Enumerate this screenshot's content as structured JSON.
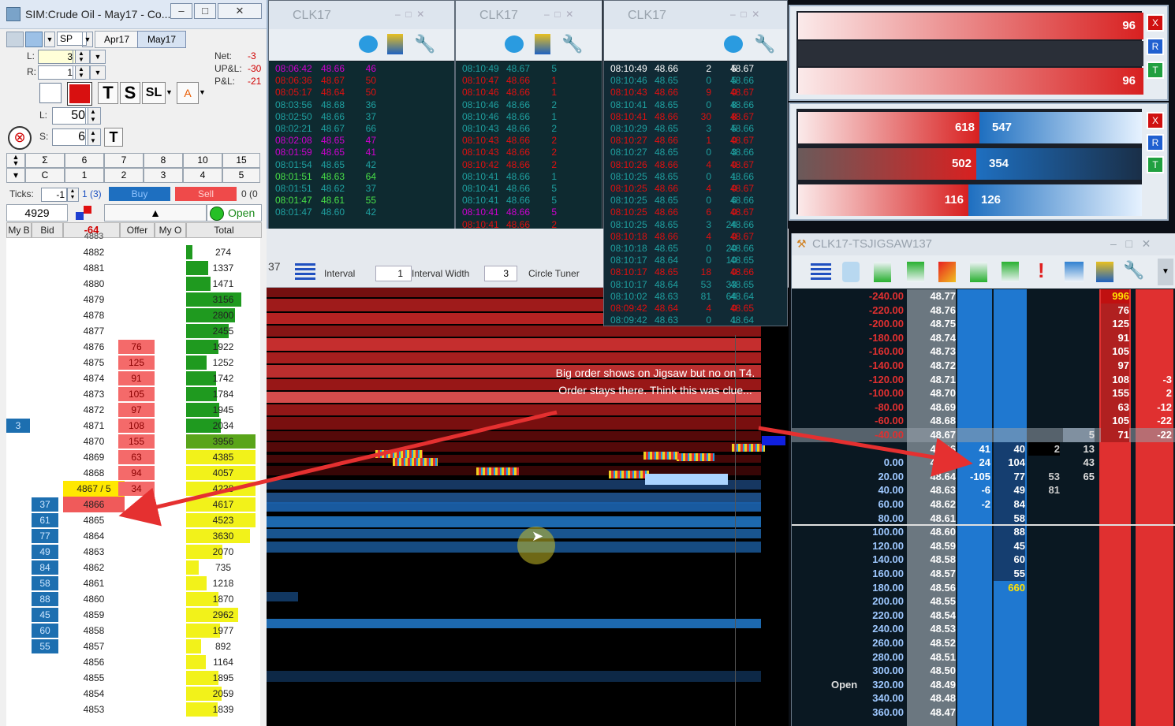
{
  "dom": {
    "title": "SIM:Crude Oil - May17 - Co...",
    "sp": "SP",
    "months": [
      "Apr17",
      "May17"
    ],
    "L_label": "L:",
    "L_value": "3",
    "R_label": "R:",
    "R_value": "1",
    "net_label": "Net:",
    "net_value": "-3",
    "upl_label": "UP&L:",
    "upl_value": "-30",
    "pl_label": "P&L:",
    "pl_value": "-21",
    "lot_L_label": "L:",
    "lot_L_value": "50",
    "lot_S_label": "S:",
    "lot_S_value": "6",
    "btn_T": "T",
    "btn_S": "S",
    "btn_SL": "SL",
    "btn_T2": "T",
    "grid_top": [
      "Σ",
      "6",
      "7",
      "8",
      "10",
      "15"
    ],
    "grid_bottom": [
      "C",
      "1",
      "2",
      "3",
      "4",
      "5"
    ],
    "ticks_label": "Ticks:",
    "ticks_value": "-1",
    "ticks_info": "1 (3)",
    "buy": "Buy",
    "sell": "Sell",
    "side_info": "0 (0",
    "last_price": "4929",
    "status": "Open",
    "headers": [
      "My B",
      "Bid",
      "-64",
      "Offer",
      "My O",
      "Total"
    ],
    "top_cut": "4883",
    "rows": [
      {
        "p": "4882",
        "t": "274",
        "tw": 8,
        "tc": "#1f9a1f"
      },
      {
        "p": "4881",
        "t": "1337",
        "tw": 30,
        "tc": "#1f9a1f"
      },
      {
        "p": "4880",
        "t": "1471",
        "tw": 33,
        "tc": "#1f9a1f"
      },
      {
        "p": "4879",
        "t": "3156",
        "tw": 74,
        "tc": "#1f9a1f"
      },
      {
        "p": "4878",
        "t": "2800",
        "tw": 66,
        "tc": "#1f9a1f"
      },
      {
        "p": "4877",
        "t": "2455",
        "tw": 57,
        "tc": "#1f9a1f"
      },
      {
        "p": "4876",
        "o": "76",
        "t": "1922",
        "tw": 44,
        "tc": "#1f9a1f"
      },
      {
        "p": "4875",
        "o": "125",
        "t": "1252",
        "tw": 28,
        "tc": "#1f9a1f"
      },
      {
        "p": "4874",
        "o": "91",
        "t": "1742",
        "tw": 40,
        "tc": "#1f9a1f"
      },
      {
        "p": "4873",
        "o": "105",
        "t": "1784",
        "tw": 41,
        "tc": "#1f9a1f"
      },
      {
        "p": "4872",
        "o": "97",
        "t": "1945",
        "tw": 45,
        "tc": "#1f9a1f"
      },
      {
        "p": "4871",
        "o": "108",
        "t": "2034",
        "tw": 47,
        "tc": "#1f9a1f",
        "mb": "3"
      },
      {
        "p": "4870",
        "o": "155",
        "t": "3956",
        "tw": 94,
        "tc": "#5aa51a"
      },
      {
        "p": "4869",
        "o": "63",
        "t": "4385",
        "tw": 94,
        "tc": "#f2f21a"
      },
      {
        "p": "4868",
        "o": "94",
        "t": "4057",
        "tw": 94,
        "tc": "#f2f21a"
      },
      {
        "p": "4867 / 5",
        "o": "34",
        "t": "4238",
        "tw": 94,
        "tc": "#f2f21a",
        "last": true
      },
      {
        "p": "4866",
        "b": "37",
        "t": "4617",
        "tw": 94,
        "tc": "#f2f21a",
        "bidrow": true
      },
      {
        "p": "4865",
        "b": "61",
        "t": "4523",
        "tw": 94,
        "tc": "#f2f21a"
      },
      {
        "p": "4864",
        "b": "77",
        "t": "3630",
        "tw": 86,
        "tc": "#f2f21a"
      },
      {
        "p": "4863",
        "b": "49",
        "t": "2070",
        "tw": 49,
        "tc": "#f2f21a"
      },
      {
        "p": "4862",
        "b": "84",
        "t": "735",
        "tw": 17,
        "tc": "#f2f21a"
      },
      {
        "p": "4861",
        "b": "58",
        "t": "1218",
        "tw": 28,
        "tc": "#f2f21a"
      },
      {
        "p": "4860",
        "b": "88",
        "t": "1870",
        "tw": 44,
        "tc": "#f2f21a"
      },
      {
        "p": "4859",
        "b": "45",
        "t": "2962",
        "tw": 70,
        "tc": "#f2f21a"
      },
      {
        "p": "4858",
        "b": "60",
        "t": "1977",
        "tw": 46,
        "tc": "#f2f21a"
      },
      {
        "p": "4857",
        "b": "55",
        "t": "892",
        "tw": 20,
        "tc": "#f2f21a"
      },
      {
        "p": "4856",
        "t": "1164",
        "tw": 27,
        "tc": "#f2f21a"
      },
      {
        "p": "4855",
        "t": "1895",
        "tw": 44,
        "tc": "#f2f21a"
      },
      {
        "p": "4854",
        "t": "2059",
        "tw": 48,
        "tc": "#f2f21a"
      },
      {
        "p": "4853",
        "t": "1839",
        "tw": 43,
        "tc": "#f2f21a"
      }
    ]
  },
  "ts1": {
    "title": "CLK17",
    "rows": [
      [
        "08:06:42",
        "48.66",
        "46",
        "#d000d0"
      ],
      [
        "08:06:36",
        "48.67",
        "50",
        "#e01010"
      ],
      [
        "08:05:17",
        "48.64",
        "50",
        "#e01010"
      ],
      [
        "08:03:56",
        "48.68",
        "36",
        "#1fa0a0"
      ],
      [
        "08:02:50",
        "48.66",
        "37",
        "#1fa0a0"
      ],
      [
        "08:02:21",
        "48.67",
        "66",
        "#1fa0a0"
      ],
      [
        "08:02:08",
        "48.65",
        "47",
        "#d000d0"
      ],
      [
        "08:01:59",
        "48.65",
        "41",
        "#d000d0"
      ],
      [
        "08:01:54",
        "48.65",
        "42",
        "#1fa0a0"
      ],
      [
        "08:01:51",
        "48.63",
        "64",
        "#48e048"
      ],
      [
        "08:01:51",
        "48.62",
        "37",
        "#1fa0a0"
      ],
      [
        "08:01:47",
        "48.61",
        "55",
        "#48e048"
      ],
      [
        "08:01:47",
        "48.60",
        "42",
        "#1fa0a0"
      ]
    ]
  },
  "ts2": {
    "title": "CLK17",
    "rows": [
      [
        "08:10:49",
        "48.67",
        "5",
        "#1fa0a0"
      ],
      [
        "08:10:47",
        "48.66",
        "1",
        "#e01010"
      ],
      [
        "08:10:46",
        "48.66",
        "1",
        "#e01010"
      ],
      [
        "08:10:46",
        "48.66",
        "2",
        "#1fa0a0"
      ],
      [
        "08:10:46",
        "48.66",
        "1",
        "#1fa0a0"
      ],
      [
        "08:10:43",
        "48.66",
        "2",
        "#1fa0a0"
      ],
      [
        "08:10:43",
        "48.66",
        "2",
        "#e01010"
      ],
      [
        "08:10:43",
        "48.66",
        "2",
        "#e01010"
      ],
      [
        "08:10:42",
        "48.66",
        "2",
        "#e01010"
      ],
      [
        "08:10:41",
        "48.66",
        "1",
        "#1fa0a0"
      ],
      [
        "08:10:41",
        "48.66",
        "5",
        "#1fa0a0"
      ],
      [
        "08:10:41",
        "48.66",
        "5",
        "#1fa0a0"
      ],
      [
        "08:10:41",
        "48.66",
        "5",
        "#d000d0"
      ],
      [
        "08:10:41",
        "48.66",
        "2",
        "#e01010"
      ]
    ]
  },
  "ts3": {
    "title": "CLK17",
    "rows": [
      [
        "08:10:49",
        "48.66",
        "2",
        "5",
        "48.67",
        "#ffffff"
      ],
      [
        "08:10:46",
        "48.65",
        "0",
        "5",
        "48.66",
        "#1fa0a0"
      ],
      [
        "08:10:43",
        "48.66",
        "9",
        "0",
        "48.67",
        "#e01010"
      ],
      [
        "08:10:41",
        "48.65",
        "0",
        "8",
        "48.66",
        "#1fa0a0"
      ],
      [
        "08:10:41",
        "48.66",
        "30",
        "8",
        "48.67",
        "#e01010"
      ],
      [
        "08:10:29",
        "48.65",
        "3",
        "5",
        "48.66",
        "#1fa0a0"
      ],
      [
        "08:10:27",
        "48.66",
        "1",
        "0",
        "48.67",
        "#e01010"
      ],
      [
        "08:10:27",
        "48.65",
        "0",
        "3",
        "48.66",
        "#1fa0a0"
      ],
      [
        "08:10:26",
        "48.66",
        "4",
        "0",
        "48.67",
        "#e01010"
      ],
      [
        "08:10:25",
        "48.65",
        "0",
        "1",
        "48.66",
        "#1fa0a0"
      ],
      [
        "08:10:25",
        "48.66",
        "4",
        "0",
        "48.67",
        "#e01010"
      ],
      [
        "08:10:25",
        "48.65",
        "0",
        "6",
        "48.66",
        "#1fa0a0"
      ],
      [
        "08:10:25",
        "48.66",
        "6",
        "0",
        "48.67",
        "#e01010"
      ],
      [
        "08:10:25",
        "48.65",
        "3",
        "24",
        "48.66",
        "#1fa0a0"
      ],
      [
        "08:10:18",
        "48.66",
        "4",
        "0",
        "48.67",
        "#e01010"
      ],
      [
        "08:10:18",
        "48.65",
        "0",
        "20",
        "48.66",
        "#1fa0a0"
      ],
      [
        "08:10:17",
        "48.64",
        "0",
        "10",
        "48.65",
        "#1fa0a0"
      ],
      [
        "08:10:17",
        "48.65",
        "18",
        "0",
        "48.66",
        "#e01010"
      ],
      [
        "08:10:17",
        "48.64",
        "53",
        "33",
        "48.65",
        "#1fa0a0"
      ],
      [
        "08:10:02",
        "48.63",
        "81",
        "64",
        "48.64",
        "#1fa0a0"
      ],
      [
        "08:09:42",
        "48.64",
        "4",
        "0",
        "48.65",
        "#e01010"
      ],
      [
        "08:09:42",
        "48.63",
        "0",
        "1",
        "48.64",
        "#1fa0a0"
      ]
    ]
  },
  "heat": {
    "title_frag": "37",
    "interval_label": "Interval",
    "interval_value": "1",
    "width_label": "Interval Width",
    "width_value": "3",
    "circle_label": "Circle Tuner"
  },
  "annotation": "Big order shows on Jigsaw but no on T4. Order stays there. Think this was clue...",
  "meter1": {
    "top": "96",
    "bottom": "96"
  },
  "meter2": [
    [
      "618",
      "547"
    ],
    [
      "502",
      "354"
    ],
    [
      "116",
      "126"
    ]
  ],
  "side_btns": [
    "X",
    "R",
    "T"
  ],
  "jig": {
    "title": "CLK17-TSJIGSAW137",
    "open_label": "Open",
    "rows": [
      {
        "pl": "-240.00",
        "p": "48.77",
        "r": "996",
        "rc": "#ffe000"
      },
      {
        "pl": "-220.00",
        "p": "48.76",
        "r": "76"
      },
      {
        "pl": "-200.00",
        "p": "48.75",
        "r": "125"
      },
      {
        "pl": "-180.00",
        "p": "48.74",
        "r": "91"
      },
      {
        "pl": "-160.00",
        "p": "48.73",
        "r": "105"
      },
      {
        "pl": "-140.00",
        "p": "48.72",
        "r": "97"
      },
      {
        "pl": "-120.00",
        "p": "48.71",
        "r": "108",
        "e": "-3"
      },
      {
        "pl": "-100.00",
        "p": "48.70",
        "r": "155",
        "e": "2"
      },
      {
        "pl": "-80.00",
        "p": "48.69",
        "r": "63",
        "e": "-12"
      },
      {
        "pl": "-60.00",
        "p": "48.68",
        "r": "105",
        "e": "-22"
      },
      {
        "pl": "-40.00",
        "p": "48.67",
        "a": "5",
        "r": "71",
        "e": "-22",
        "hl": true
      },
      {
        "pl": "",
        "p": "48.66",
        "b1": "41",
        "b2": "40",
        "x": "2",
        "a": "13"
      },
      {
        "pl": "0.00",
        "p": "48.65",
        "b1": "24",
        "b2": "104",
        "a": "43"
      },
      {
        "pl": "20.00",
        "p": "48.64",
        "b1": "-105",
        "b2": "77",
        "x": "53",
        "a": "65"
      },
      {
        "pl": "40.00",
        "p": "48.63",
        "b1": "-6",
        "b2": "49",
        "x": "81"
      },
      {
        "pl": "60.00",
        "p": "48.62",
        "b1": "-2",
        "b2": "84"
      },
      {
        "pl": "80.00",
        "p": "48.61",
        "b2": "58"
      },
      {
        "pl": "100.00",
        "p": "48.60",
        "b2": "88"
      },
      {
        "pl": "120.00",
        "p": "48.59",
        "b2": "45"
      },
      {
        "pl": "140.00",
        "p": "48.58",
        "b2": "60"
      },
      {
        "pl": "160.00",
        "p": "48.57",
        "b2": "55"
      },
      {
        "pl": "180.00",
        "p": "48.56",
        "b2": "660",
        "b2c": "#ffe000"
      },
      {
        "pl": "200.00",
        "p": "48.55"
      },
      {
        "pl": "220.00",
        "p": "48.54"
      },
      {
        "pl": "240.00",
        "p": "48.53"
      },
      {
        "pl": "260.00",
        "p": "48.52"
      },
      {
        "pl": "280.00",
        "p": "48.51"
      },
      {
        "pl": "300.00",
        "p": "48.50"
      },
      {
        "pl": "320.00",
        "p": "48.49",
        "open": true
      },
      {
        "pl": "340.00",
        "p": "48.48"
      },
      {
        "pl": "360.00",
        "p": "48.47"
      }
    ]
  }
}
